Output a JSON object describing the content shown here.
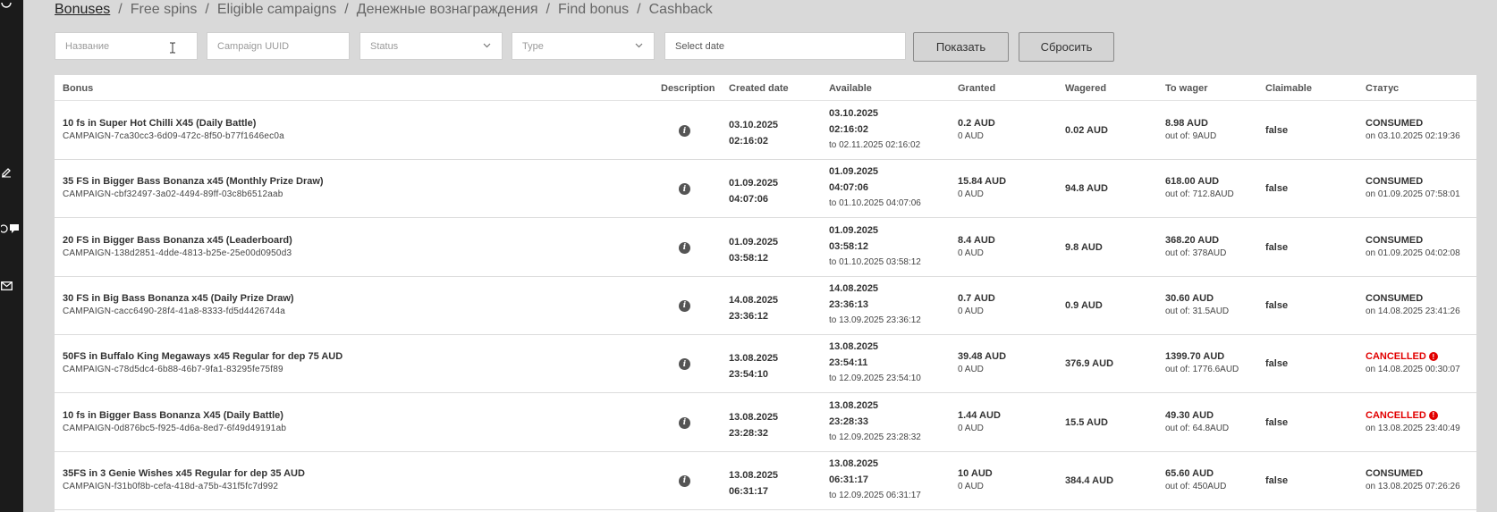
{
  "breadcrumb": {
    "items": [
      "Bonuses",
      "Free spins",
      "Eligible campaigns",
      "Денежные вознаграждения",
      "Find bonus",
      "Cashback"
    ],
    "separator": "/"
  },
  "filters": {
    "name_placeholder": "Название",
    "uuid_placeholder": "Campaign UUID",
    "status_placeholder": "Status",
    "type_placeholder": "Type",
    "date_placeholder": "Select date",
    "show_label": "Показать",
    "reset_label": "Сбросить"
  },
  "table": {
    "columns": {
      "bonus": "Bonus",
      "description": "Description",
      "created": "Created date",
      "available": "Available",
      "granted": "Granted",
      "wagered": "Wagered",
      "to_wager": "To wager",
      "claimable": "Claimable",
      "status": "Статус"
    },
    "rows": [
      {
        "name": "10 fs in Super Hot Chilli X45 (Daily Battle)",
        "campaign": "CAMPAIGN-7ca30cc3-6d09-472c-8f50-b77f1646ec0a",
        "created_date": "03.10.2025",
        "created_time": "02:16:02",
        "avail_date": "03.10.2025",
        "avail_time": "02:16:02",
        "avail_to": "to 02.11.2025 02:16:02",
        "granted": "0.2 AUD",
        "granted_sub": "0 AUD",
        "wagered": "0.02 AUD",
        "to_wager": "8.98 AUD",
        "to_wager_sub": "out of: 9AUD",
        "claimable": "false",
        "status": "CONSUMED",
        "status_on": "on 03.10.2025 02:19:36",
        "cancelled": false
      },
      {
        "name": "35 FS in Bigger Bass Bonanza x45 (Monthly Prize Draw)",
        "campaign": "CAMPAIGN-cbf32497-3a02-4494-89ff-03c8b6512aab",
        "created_date": "01.09.2025",
        "created_time": "04:07:06",
        "avail_date": "01.09.2025",
        "avail_time": "04:07:06",
        "avail_to": "to 01.10.2025 04:07:06",
        "granted": "15.84 AUD",
        "granted_sub": "0 AUD",
        "wagered": "94.8 AUD",
        "to_wager": "618.00 AUD",
        "to_wager_sub": "out of: 712.8AUD",
        "claimable": "false",
        "status": "CONSUMED",
        "status_on": "on 01.09.2025 07:58:01",
        "cancelled": false
      },
      {
        "name": "20 FS in Bigger Bass Bonanza x45 (Leaderboard)",
        "campaign": "CAMPAIGN-138d2851-4dde-4813-b25e-25e00d0950d3",
        "created_date": "01.09.2025",
        "created_time": "03:58:12",
        "avail_date": "01.09.2025",
        "avail_time": "03:58:12",
        "avail_to": "to 01.10.2025 03:58:12",
        "granted": "8.4 AUD",
        "granted_sub": "0 AUD",
        "wagered": "9.8 AUD",
        "to_wager": "368.20 AUD",
        "to_wager_sub": "out of: 378AUD",
        "claimable": "false",
        "status": "CONSUMED",
        "status_on": "on 01.09.2025 04:02:08",
        "cancelled": false
      },
      {
        "name": "30 FS in Big Bass Bonanza x45 (Daily Prize Draw)",
        "campaign": "CAMPAIGN-cacc6490-28f4-41a8-8333-fd5d4426744a",
        "created_date": "14.08.2025",
        "created_time": "23:36:12",
        "avail_date": "14.08.2025",
        "avail_time": "23:36:13",
        "avail_to": "to 13.09.2025 23:36:12",
        "granted": "0.7 AUD",
        "granted_sub": "0 AUD",
        "wagered": "0.9 AUD",
        "to_wager": "30.60 AUD",
        "to_wager_sub": "out of: 31.5AUD",
        "claimable": "false",
        "status": "CONSUMED",
        "status_on": "on 14.08.2025 23:41:26",
        "cancelled": false
      },
      {
        "name": "50FS in Buffalo King Megaways x45 Regular for dep 75 AUD",
        "campaign": "CAMPAIGN-c78d5dc4-6b88-46b7-9fa1-83295fe75f89",
        "created_date": "13.08.2025",
        "created_time": "23:54:10",
        "avail_date": "13.08.2025",
        "avail_time": "23:54:11",
        "avail_to": "to 12.09.2025 23:54:10",
        "granted": "39.48 AUD",
        "granted_sub": "0 AUD",
        "wagered": "376.9 AUD",
        "to_wager": "1399.70 AUD",
        "to_wager_sub": "out of: 1776.6AUD",
        "claimable": "false",
        "status": "CANCELLED",
        "status_on": "on 14.08.2025 00:30:07",
        "cancelled": true
      },
      {
        "name": "10 fs in Bigger Bass Bonanza X45 (Daily Battle)",
        "campaign": "CAMPAIGN-0d876bc5-f925-4d6a-8ed7-6f49d49191ab",
        "created_date": "13.08.2025",
        "created_time": "23:28:32",
        "avail_date": "13.08.2025",
        "avail_time": "23:28:33",
        "avail_to": "to 12.09.2025 23:28:32",
        "granted": "1.44 AUD",
        "granted_sub": "0 AUD",
        "wagered": "15.5 AUD",
        "to_wager": "49.30 AUD",
        "to_wager_sub": "out of: 64.8AUD",
        "claimable": "false",
        "status": "CANCELLED",
        "status_on": "on 13.08.2025 23:40:49",
        "cancelled": true
      },
      {
        "name": "35FS in 3 Genie Wishes x45 Regular for dep 35 AUD",
        "campaign": "CAMPAIGN-f31b0f8b-cefa-418d-a75b-431f5fc7d992",
        "created_date": "13.08.2025",
        "created_time": "06:31:17",
        "avail_date": "13.08.2025",
        "avail_time": "06:31:17",
        "avail_to": "to 12.09.2025 06:31:17",
        "granted": "10 AUD",
        "granted_sub": "0 AUD",
        "wagered": "384.4 AUD",
        "to_wager": "65.60 AUD",
        "to_wager_sub": "out of: 450AUD",
        "claimable": "false",
        "status": "CONSUMED",
        "status_on": "on 13.08.2025 07:26:26",
        "cancelled": false
      }
    ]
  },
  "colors": {
    "cancelled": "#e20000",
    "rail": "#1b1b1b",
    "page_bg": "#d9d9d9"
  },
  "icons": {
    "info": "i",
    "alert": "!"
  }
}
